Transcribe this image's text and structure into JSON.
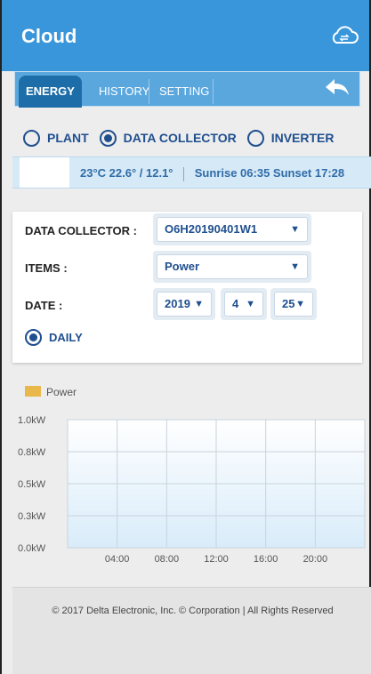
{
  "app": {
    "title": "Cloud"
  },
  "tabs": [
    {
      "label": "ENERGY",
      "active": true
    },
    {
      "label": "HISTORY",
      "active": false
    },
    {
      "label": "SETTING",
      "active": false
    }
  ],
  "radios": {
    "plant": "PLANT",
    "data_collector": "DATA COLLECTOR",
    "inverter": "INVERTER",
    "selected": "data_collector"
  },
  "weather": {
    "temp": "23°C",
    "range": "22.6° / 12.1°",
    "sun": "Sunrise 06:35 Sunset 17:28"
  },
  "form": {
    "collector_label": "DATA COLLECTOR :",
    "collector_value": "O6H20190401W1",
    "items_label": "ITEMS :",
    "items_value": "Power",
    "date_label": "DATE :",
    "year": "2019",
    "month": "4",
    "day": "25",
    "period": "DAILY"
  },
  "chart_data": {
    "type": "area",
    "legend": [
      "Power"
    ],
    "legend_color": "#e8b84a",
    "y_ticks": [
      "1.0kW",
      "0.8kW",
      "0.5kW",
      "0.3kW",
      "0.0kW"
    ],
    "x_ticks": [
      "04:00",
      "08:00",
      "12:00",
      "16:00",
      "20:00"
    ],
    "series": [
      {
        "name": "Power",
        "values": []
      }
    ],
    "ylim": [
      0,
      1.0
    ]
  },
  "footer": {
    "text": "© 2017 Delta Electronic, Inc. © Corporation | All Rights Reserved"
  },
  "colors": {
    "primary": "#3a96da",
    "accent": "#1f4f8f",
    "tab_active": "#1d6ea8"
  }
}
